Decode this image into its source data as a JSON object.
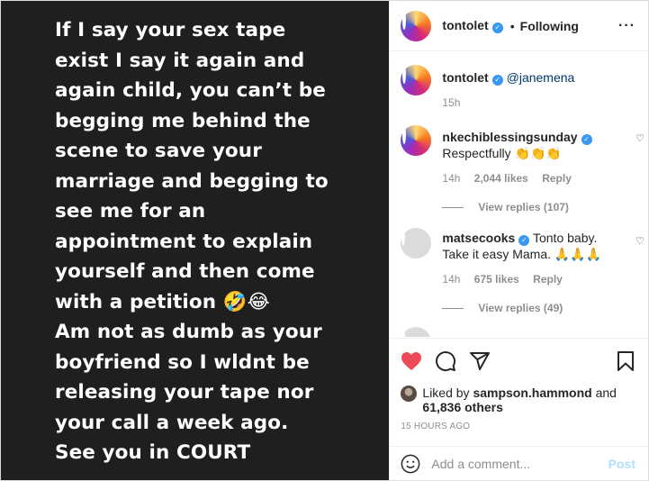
{
  "media": {
    "lines": [
      "If I say your sex tape",
      "exist I say it again and",
      "again child, you can’t be",
      "begging me behind the",
      "scene to save your",
      "marriage and begging to",
      "see me for an",
      "appointment to explain",
      "yourself and then come",
      "with a petition 🤣😂",
      "Am not as dumb as your",
      "boyfriend so I wldnt be",
      "releasing your tape nor",
      "your call a week ago.",
      "See you in COURT"
    ]
  },
  "header": {
    "username": "tontolet",
    "separator": "•",
    "follow_status": "Following",
    "more": "···"
  },
  "caption": {
    "username": "tontolet",
    "mention": "@janemena",
    "time": "15h"
  },
  "comments": [
    {
      "username": "nkechiblessingsunday",
      "text": "Respectfully 👏👏👏",
      "time": "14h",
      "likes": "2,044 likes",
      "reply": "Reply",
      "view_replies": "View replies (107)"
    },
    {
      "username": "matsecooks",
      "text": "Tonto baby. Take it easy Mama. 🙏🙏🙏",
      "time": "14h",
      "likes": "675 likes",
      "reply": "Reply",
      "view_replies": "View replies (49)"
    }
  ],
  "likes": {
    "prefix": "Liked by",
    "user": "sampson.hammond",
    "and": "and",
    "others": "61,836 others"
  },
  "timestamp": "15 HOURS AGO",
  "add_comment": {
    "placeholder": "Add a comment...",
    "post": "Post"
  },
  "colors": {
    "like_red": "#ed4956",
    "verified_blue": "#3897f0",
    "post_disabled": "#b2dffc",
    "media_bg": "#1f1f1f"
  }
}
